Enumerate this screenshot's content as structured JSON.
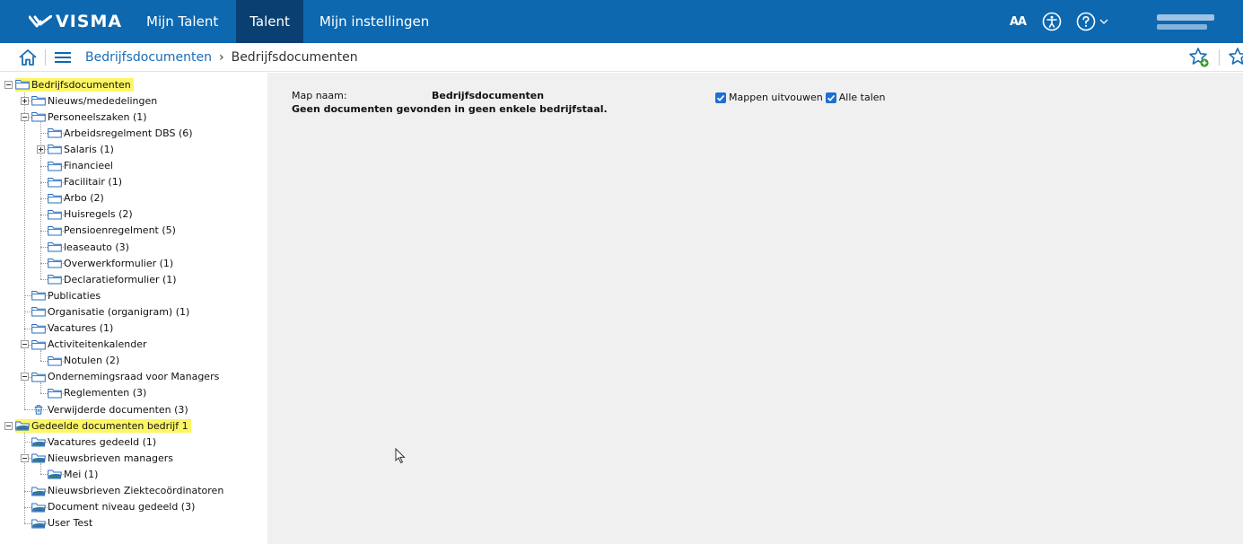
{
  "app": {
    "brand": "VISMA",
    "nav_tabs": [
      {
        "label": "Mijn Talent",
        "active": false
      },
      {
        "label": "Talent",
        "active": true
      },
      {
        "label": "Mijn instellingen",
        "active": false
      }
    ],
    "text_size_label": "AA",
    "accent_color": "#0d68b0",
    "active_tab_color": "#0a3f72"
  },
  "breadcrumb": {
    "link": "Bedrijfsdocumenten",
    "separator": "›",
    "current": "Bedrijfsdocumenten"
  },
  "tree": {
    "highlight_color": "#fdf663",
    "nodes": [
      {
        "label": "Bedrijfsdocumenten",
        "level": 0,
        "expander": "minus",
        "folder": "plain",
        "highlight": true
      },
      {
        "label": "Nieuws/mededelingen",
        "level": 1,
        "expander": "plus",
        "folder": "plain"
      },
      {
        "label": "Personeelszaken (1)",
        "level": 1,
        "expander": "minus",
        "folder": "plain"
      },
      {
        "label": "Arbeidsregelment DBS (6)",
        "level": 2,
        "expander": "none",
        "folder": "plain"
      },
      {
        "label": "Salaris (1)",
        "level": 2,
        "expander": "plus",
        "folder": "plain"
      },
      {
        "label": "Financieel",
        "level": 2,
        "expander": "none",
        "folder": "plain"
      },
      {
        "label": "Facilitair (1)",
        "level": 2,
        "expander": "none",
        "folder": "plain"
      },
      {
        "label": "Arbo (2)",
        "level": 2,
        "expander": "none",
        "folder": "plain"
      },
      {
        "label": "Huisregels (2)",
        "level": 2,
        "expander": "none",
        "folder": "plain"
      },
      {
        "label": "Pensioenregelment (5)",
        "level": 2,
        "expander": "none",
        "folder": "plain"
      },
      {
        "label": "leaseauto (3)",
        "level": 2,
        "expander": "none",
        "folder": "plain"
      },
      {
        "label": "Overwerkformulier (1)",
        "level": 2,
        "expander": "none",
        "folder": "plain"
      },
      {
        "label": "Declaratieformulier (1)",
        "level": 2,
        "expander": "none",
        "folder": "plain"
      },
      {
        "label": "Publicaties",
        "level": 1,
        "expander": "none",
        "folder": "plain"
      },
      {
        "label": "Organisatie (organigram) (1)",
        "level": 1,
        "expander": "none",
        "folder": "plain"
      },
      {
        "label": "Vacatures (1)",
        "level": 1,
        "expander": "none",
        "folder": "plain"
      },
      {
        "label": "Activiteitenkalender",
        "level": 1,
        "expander": "minus",
        "folder": "plain"
      },
      {
        "label": "Notulen (2)",
        "level": 2,
        "expander": "none",
        "folder": "plain"
      },
      {
        "label": "Ondernemingsraad voor Managers",
        "level": 1,
        "expander": "minus",
        "folder": "plain"
      },
      {
        "label": "Reglementen (3)",
        "level": 2,
        "expander": "none",
        "folder": "plain"
      },
      {
        "label": "Verwijderde documenten (3)",
        "level": 1,
        "expander": "none",
        "folder": "trash"
      },
      {
        "label": "Gedeelde documenten bedrijf 1",
        "level": 0,
        "expander": "minus",
        "folder": "shared",
        "highlight": true
      },
      {
        "label": "Vacatures gedeeld (1)",
        "level": 1,
        "expander": "none",
        "folder": "shared"
      },
      {
        "label": "Nieuwsbrieven managers",
        "level": 1,
        "expander": "minus",
        "folder": "shared"
      },
      {
        "label": "Mei (1)",
        "level": 2,
        "expander": "none",
        "folder": "shared"
      },
      {
        "label": "Nieuwsbrieven Ziektecoördinatoren",
        "level": 1,
        "expander": "none",
        "folder": "shared"
      },
      {
        "label": "Document niveau gedeeld (3)",
        "level": 1,
        "expander": "none",
        "folder": "shared"
      },
      {
        "label": "User Test",
        "level": 1,
        "expander": "none",
        "folder": "shared"
      }
    ]
  },
  "main": {
    "folder_name_label": "Map naam:",
    "folder_name_value": "Bedrijfsdocumenten",
    "message": "Geen documenten gevonden in geen enkele bedrijfstaal.",
    "option_expand_folders": {
      "label": "Mappen uitvouwen",
      "checked": true
    },
    "option_all_languages": {
      "label": "Alle talen",
      "checked": true
    }
  }
}
